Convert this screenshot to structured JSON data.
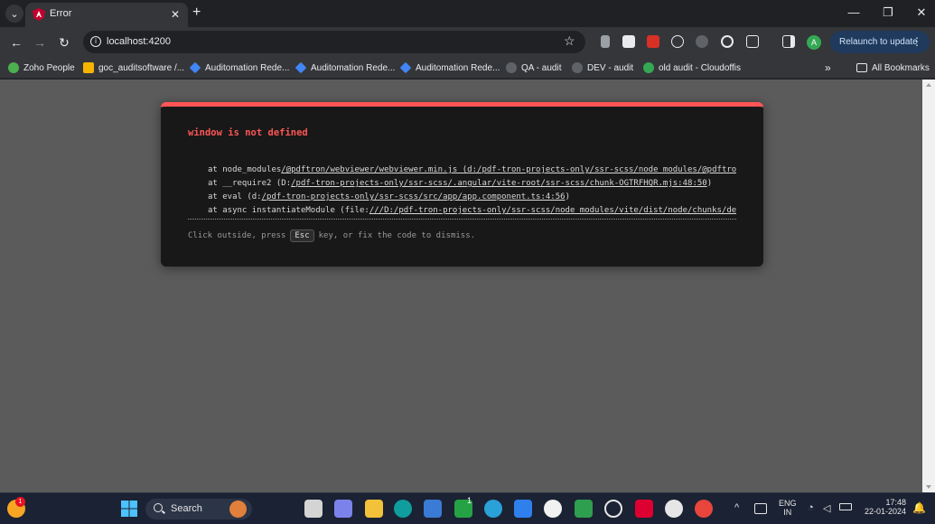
{
  "browser": {
    "tab": {
      "title": "Error"
    },
    "url": "localhost:4200",
    "relaunch_label": "Relaunch to update",
    "profile_initial": "A",
    "bookmarks": [
      {
        "label": "Zoho People",
        "color": "#4caf50"
      },
      {
        "label": "goc_auditsoftware /...",
        "color": "#f4b400"
      },
      {
        "label": "Auditomation Rede...",
        "color": "#4285f4"
      },
      {
        "label": "Auditomation Rede...",
        "color": "#4285f4"
      },
      {
        "label": "Auditomation Rede...",
        "color": "#4285f4"
      },
      {
        "label": "QA - audit",
        "color": "#5f6368"
      },
      {
        "label": "DEV - audit",
        "color": "#5f6368"
      },
      {
        "label": "old audit - Cloudoffis",
        "color": "#34a853"
      }
    ],
    "bookmarks_overflow": "»",
    "all_bookmarks_label": "All Bookmarks"
  },
  "error_overlay": {
    "message": "window is not defined",
    "stack": [
      {
        "prefix": "at node_modules",
        "link": "/@pdftron/webviewer/webviewer.min.js (d:/pdf-tron-projects-only/ssr-scss/node_modules/@pdftro",
        "suffix": ""
      },
      {
        "prefix": "at __require2 (D:",
        "link": "/pdf-tron-projects-only/ssr-scss/.angular/vite-root/ssr-scss/chunk-OGTRFHQR.mjs:48:50",
        "suffix": ")"
      },
      {
        "prefix": "at eval (d:",
        "link": "/pdf-tron-projects-only/ssr-scss/src/app/app.component.ts:4:56",
        "suffix": ")"
      },
      {
        "prefix": "at async instantiateModule (file:",
        "link": "///D:/pdf-tron-projects-only/ssr-scss/node_modules/vite/dist/node/chunks/de",
        "suffix": ""
      }
    ],
    "tip_before": "Click outside, press",
    "tip_key": "Esc",
    "tip_after": "key, or fix the code to dismiss."
  },
  "taskbar": {
    "search_label": "Search",
    "chat_badge": "1",
    "weather_badge": "1",
    "language": "ENG",
    "region": "IN",
    "time": "17:48",
    "date": "22-01-2024"
  },
  "colors": {
    "error_accent": "#ff5555",
    "page_dim": "#5b5b5b",
    "relaunch_bg": "#1f3a5c"
  }
}
